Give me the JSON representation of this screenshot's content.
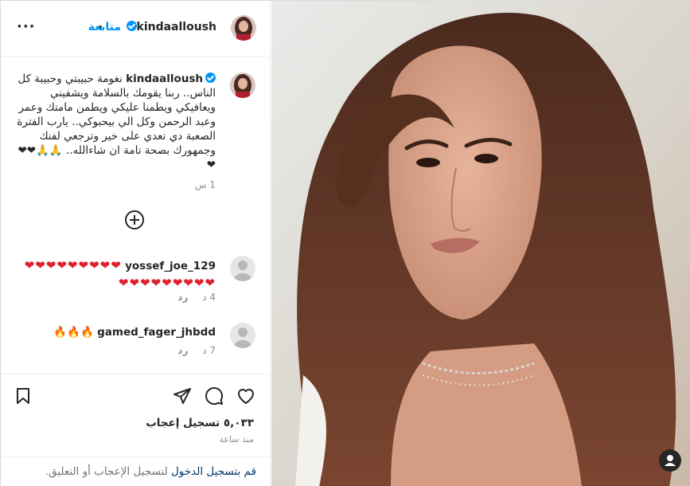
{
  "post": {
    "username": "kindaalloush",
    "follow_label": "متابعة",
    "dot": "•",
    "more_label": "···"
  },
  "caption": {
    "author": "kindaalloush",
    "text": "نغومة حبيبتي وحبيبة كل الناس.. ربنا يقومك بالسلامة ويشفيني ويعافيكي ويطمنا عليكي ويطمن مامتك وعمر وعبد الرحمن وكل الي بيحبوكي.. يارب الفترة الصعبة دي تعدي على خير وترجعي لفنك وجمهورك بصحة تامة ان شاءالله.. 🙏🙏❤❤❤",
    "time": "1 س"
  },
  "comments": [
    {
      "author": "yossef_joe_129",
      "text": "❤❤❤❤❤❤❤❤❤❤❤❤❤❤❤❤❤❤",
      "time": "4 د",
      "reply": "رد"
    },
    {
      "author": "gamed_fager_jhbdd",
      "text": "🔥🔥🔥",
      "time": "7 د",
      "reply": "رد"
    }
  ],
  "likes": "٥,٠٣٣ تسجيل إعجاب",
  "posted_ago": "منذ ساعة",
  "login": {
    "link": "قم بتسجيل الدخول",
    "rest": " لتسجيل الإعجاب أو التعليق."
  },
  "icons": [
    "more-icon",
    "verified-icon",
    "add-comment-icon",
    "bookmark-icon",
    "share-icon",
    "comment-icon",
    "heart-icon",
    "user-icon"
  ],
  "colors": {
    "accent": "#0095f6",
    "heart": "#e0202d",
    "muted": "#8e8e8e"
  }
}
